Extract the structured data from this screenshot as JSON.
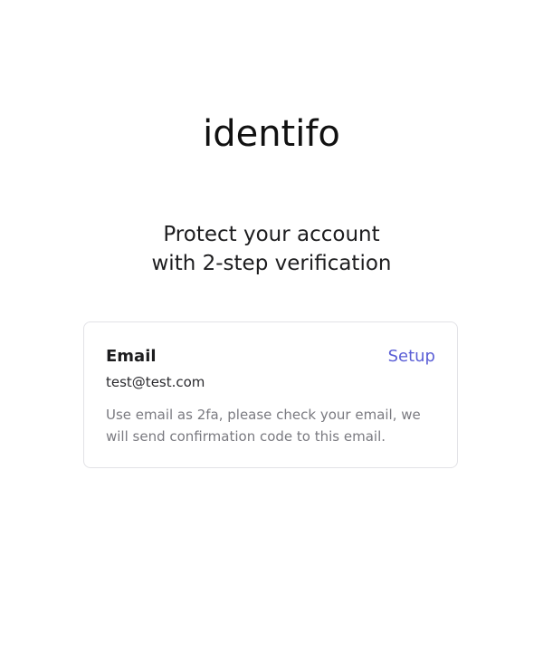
{
  "logo": {
    "text": "identifo"
  },
  "headline": {
    "line1": "Protect your account",
    "line2": "with 2-step verification"
  },
  "method_card": {
    "title": "Email",
    "action_label": "Setup",
    "email": "test@test.com",
    "description": "Use email as 2fa, please check your email, we will send confirmation code to this email."
  },
  "colors": {
    "accent": "#5b5fd6",
    "text": "#1d1d1f",
    "muted": "#7a7a80",
    "border": "#e2e2e6"
  }
}
